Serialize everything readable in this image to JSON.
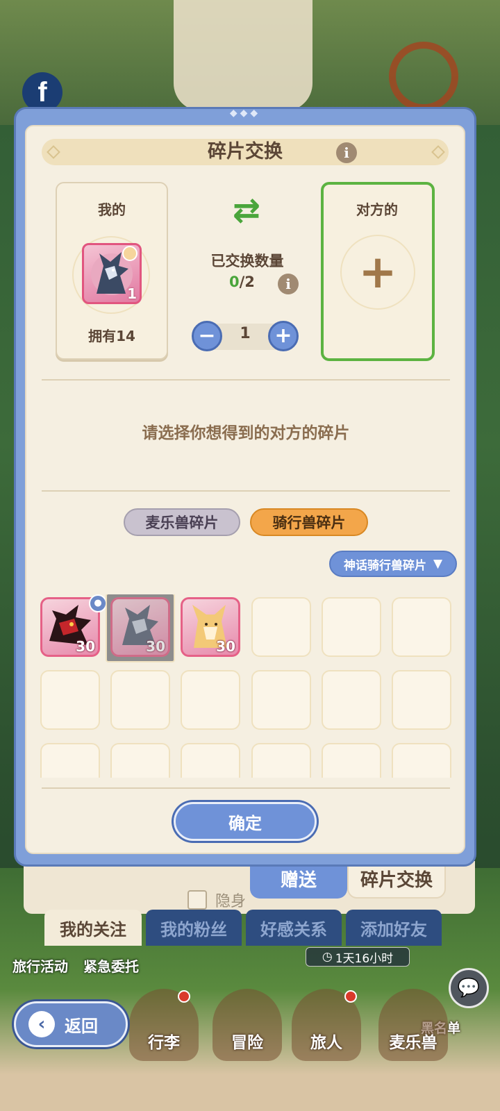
{
  "dialog": {
    "title": "碎片交换",
    "mine": {
      "label": "我的",
      "owned": "拥有14",
      "item_count": "1"
    },
    "theirs": {
      "label": "对方的"
    },
    "exchange": {
      "label": "已交换数量",
      "done": "0",
      "total": "/2"
    },
    "stepper": {
      "value": "1",
      "minus": "−",
      "plus": "+"
    },
    "prompt": "请选择你想得到的对方的碎片",
    "tabs": [
      {
        "label": "麦乐兽碎片",
        "active": false
      },
      {
        "label": "骑行兽碎片",
        "active": true
      }
    ],
    "dropdown": {
      "label": "神话骑行兽碎片",
      "arrow": "▼"
    },
    "fragments": [
      {
        "name": "red-dragon",
        "count": "30",
        "color": "#b3262a"
      },
      {
        "name": "grey-dragon",
        "count": "30",
        "color": "#6c7486"
      },
      {
        "name": "fox",
        "count": "30",
        "color": "#e7b35e"
      }
    ],
    "confirm": "确定"
  },
  "background": {
    "hide_label": "隐身",
    "side_tabs": [
      "赠送",
      "碎片交换"
    ],
    "friend_tabs": [
      "我的关注",
      "我的粉丝",
      "好感关系",
      "添加好友"
    ],
    "travel": "旅行活动",
    "urgent": "紧急委托",
    "timer": "1天16小时",
    "blacklist": "黑名单",
    "nav": [
      "行李",
      "冒险",
      "旅人",
      "麦乐兽"
    ],
    "back": "返回"
  },
  "colors": {
    "accent_blue": "#6f92d8",
    "accent_green": "#4aa53b",
    "accent_orange": "#f3a64a",
    "panel": "#f5efe1"
  }
}
